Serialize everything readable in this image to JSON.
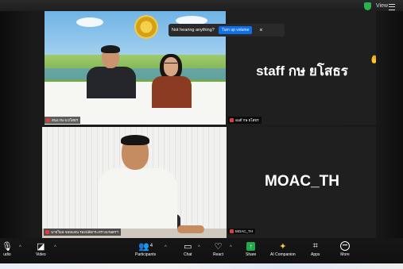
{
  "top_bar": {
    "view_label": "View",
    "shield_color": "#27b34a"
  },
  "toast": {
    "message": "Not hearing anything?",
    "button_label": "Turn up volume",
    "close": "×"
  },
  "tiles": [
    {
      "name": "สนง.กษ.จ.ยโสธร",
      "kind": "video"
    },
    {
      "name": "นายวิมล จอมแคน รองปลัดกระทรวงเกษตรฯ",
      "kind": "video"
    },
    {
      "name": "staff กษ ยโสธร",
      "display_text": "staff กษ ยโสธร",
      "kind": "name-only",
      "hand_raised": true
    },
    {
      "name": "MOAC_TH",
      "display_text": "MOAC_TH",
      "kind": "name-only"
    }
  ],
  "toolbar": {
    "audio": {
      "label": "udio",
      "icon": "microphone-icon"
    },
    "video": {
      "label": "Video",
      "icon": "video-camera-off-icon"
    },
    "participants": {
      "label": "Participants",
      "count": "4",
      "icon": "people-icon"
    },
    "chat": {
      "label": "Chat",
      "icon": "chat-bubble-icon"
    },
    "react": {
      "label": "React",
      "icon": "heart-icon"
    },
    "share": {
      "label": "Share",
      "icon": "share-arrow-icon"
    },
    "ai_companion": {
      "label": "AI Companion",
      "icon": "sparkle-icon"
    },
    "apps": {
      "label": "Apps",
      "icon": "apps-icon"
    },
    "more": {
      "label": "More",
      "icon": "more-icon"
    }
  },
  "colors": {
    "accent_blue": "#0e71eb",
    "share_green": "#22a94c",
    "mute_red": "#e03b3b"
  }
}
